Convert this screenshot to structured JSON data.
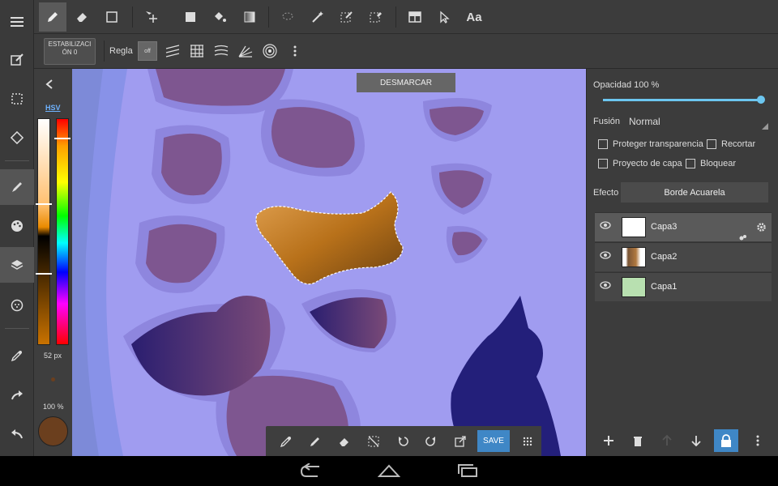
{
  "toolbar_sub": {
    "stabilization_label": "ESTABILIZACI ÓN 0",
    "ruler_label": "Regla",
    "ruler_off": "off"
  },
  "text_tool_label": "Aa",
  "color_panel": {
    "mode_label": "HSV",
    "size_label": "52 px",
    "opacity_label": "100 %",
    "current_color": "#6b3f1e"
  },
  "canvas": {
    "deselect_label": "DESMARCAR"
  },
  "bottom_toolbar": {
    "save_label": "SAVE"
  },
  "layers_panel": {
    "opacity_label": "Opacidad 100 %",
    "opacity_value": 1.0,
    "blend_label": "Fusión",
    "blend_value": "Normal",
    "protect_alpha_label": "Proteger transparencia",
    "clip_label": "Recortar",
    "project_label": "Proyecto de capa",
    "lock_label": "Bloquear",
    "effect_label": "Efecto",
    "effect_value": "Borde Acuarela",
    "layers": [
      {
        "name": "Capa3",
        "selected": true
      },
      {
        "name": "Capa2",
        "selected": false
      },
      {
        "name": "Capa1",
        "selected": false
      }
    ]
  },
  "colors": {
    "accent_blue": "#3f87c6",
    "slider_blue": "#6cc6f0",
    "canvas_bg": "#a09cf0",
    "panel_bg": "#3c3c3c"
  }
}
